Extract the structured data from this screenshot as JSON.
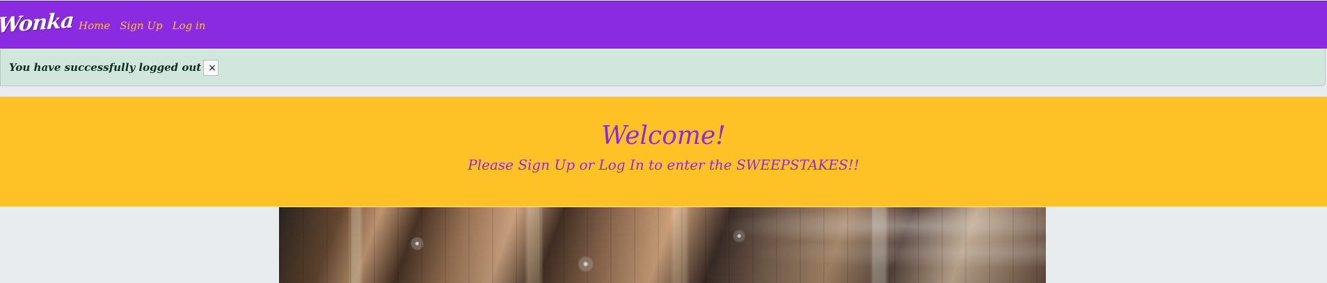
{
  "navbar": {
    "brand": "Wonka",
    "links": [
      {
        "label": "Home"
      },
      {
        "label": "Sign Up"
      },
      {
        "label": "Log in"
      }
    ],
    "colors": {
      "background": "#8a2be2",
      "link": "#ffc626"
    }
  },
  "alert": {
    "message": "You have successfully logged out",
    "close_label": "×",
    "colors": {
      "background": "#d1e7dd",
      "text": "#0f2d1f"
    }
  },
  "hero": {
    "title": "Welcome!",
    "subtitle": "Please Sign Up or Log In to enter the SWEEPSTAKES!!",
    "colors": {
      "background": "#ffc226",
      "text": "#8a2be2"
    }
  },
  "image": {
    "icon": "factory-machinery-image"
  }
}
